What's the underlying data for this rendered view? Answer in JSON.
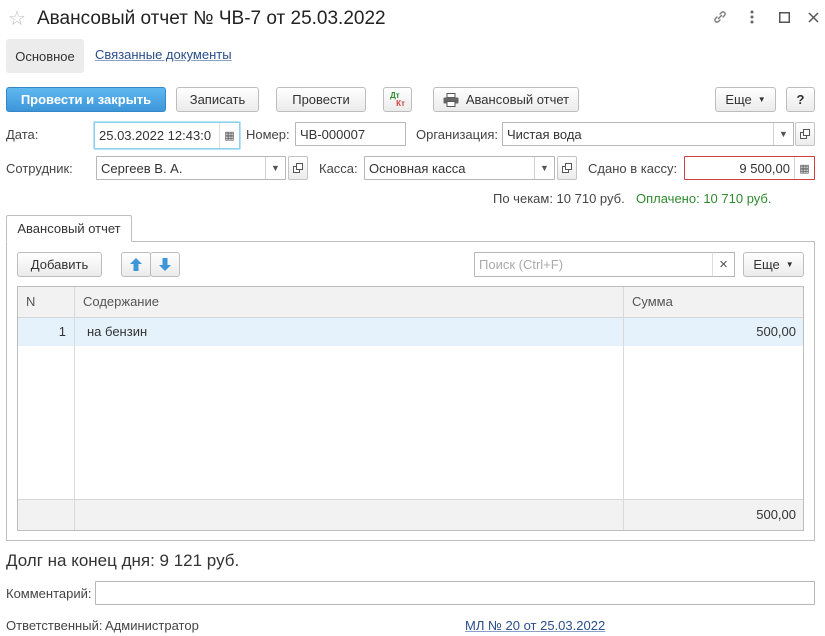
{
  "window": {
    "title": "Авансовый отчет № ЧВ-7 от 25.03.2022",
    "icons": [
      "star-icon",
      "link-icon",
      "more-vertical-icon",
      "maximize-icon",
      "close-icon"
    ]
  },
  "tabs": [
    {
      "label": "Основное",
      "active": true
    },
    {
      "label": "Связанные документы",
      "active": false
    }
  ],
  "toolbar": {
    "post_close": "Провести и закрыть",
    "save": "Записать",
    "post": "Провести",
    "dt_kt_top": "Дт",
    "dt_kt_bottom": "Кт",
    "print": "Авансовый отчет",
    "more": "Еще",
    "help": "?"
  },
  "form": {
    "date_label": "Дата:",
    "date_value": "25.03.2022 12:43:0",
    "number_label": "Номер:",
    "number_value": "ЧВ-000007",
    "org_label": "Организация:",
    "org_value": "Чистая вода",
    "employee_label": "Сотрудник:",
    "employee_value": "Сергеев В. А.",
    "cash_label": "Касса:",
    "cash_value": "Основная касса",
    "deposited_label": "Сдано в кассу:",
    "deposited_value": "9 500,00",
    "receipts_text": "По чекам: 10 710 руб.",
    "paid_text": "Оплачено: 10 710 руб."
  },
  "inner_tab": {
    "label": "Авансовый отчет"
  },
  "table_toolbar": {
    "add": "Добавить",
    "search_placeholder": "Поиск (Ctrl+F)",
    "clear": "×",
    "more": "Еще"
  },
  "table": {
    "columns": [
      "N",
      "Содержание",
      "Сумма"
    ],
    "rows": [
      {
        "n": "1",
        "content": "на бензин",
        "sum": "500,00"
      }
    ],
    "total": "500,00"
  },
  "footer": {
    "debt": "Долг на конец дня: 9 121 руб.",
    "comment_label": "Комментарий:",
    "comment_value": "",
    "responsible_label": "Ответственный:",
    "responsible_value": "Администратор",
    "related_link": "МЛ № 20 от 25.03.2022"
  },
  "colors": {
    "primary_button": "#4aa6e3",
    "link": "#2a4e8a",
    "paid_green": "#2e8b2e",
    "error_border": "#d04040",
    "row_selected": "#e5f2fb"
  }
}
